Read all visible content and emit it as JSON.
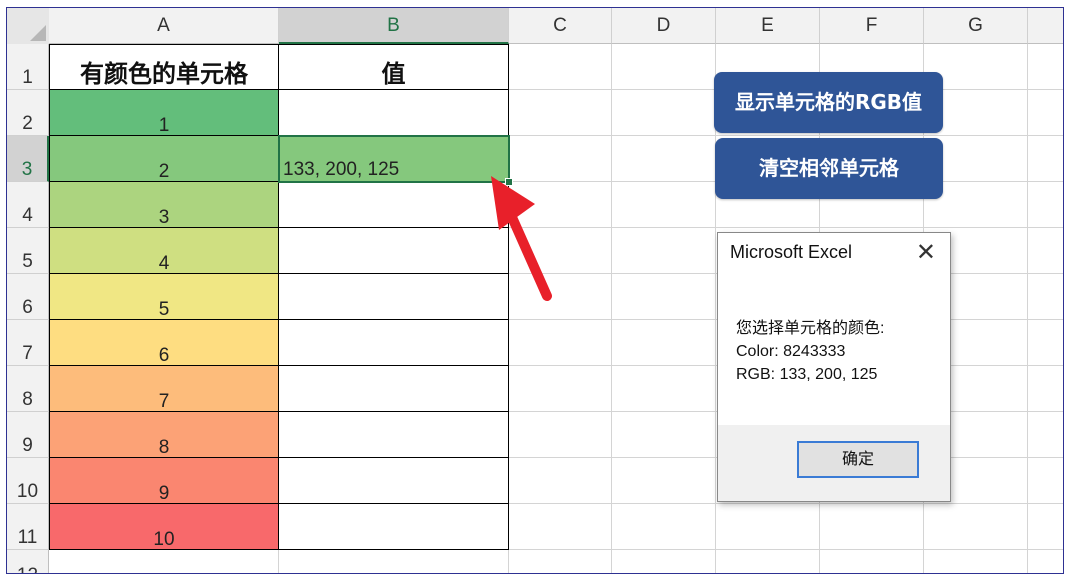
{
  "columns": [
    "A",
    "B",
    "C",
    "D",
    "E",
    "F",
    "G"
  ],
  "selected_column": "B",
  "rows": [
    "1",
    "2",
    "3",
    "4",
    "5",
    "6",
    "7",
    "8",
    "9",
    "10",
    "11",
    "12"
  ],
  "selected_row": "3",
  "table": {
    "header_a": "有颜色的单元格",
    "header_b": "值",
    "items": [
      {
        "label": "1",
        "color": "#63be7b",
        "value": ""
      },
      {
        "label": "2",
        "color": "#85c87d",
        "value": "133, 200, 125"
      },
      {
        "label": "3",
        "color": "#acd47f",
        "value": ""
      },
      {
        "label": "4",
        "color": "#cfdf81",
        "value": ""
      },
      {
        "label": "5",
        "color": "#f0e784",
        "value": ""
      },
      {
        "label": "6",
        "color": "#fedd81",
        "value": ""
      },
      {
        "label": "7",
        "color": "#fdbc7b",
        "value": ""
      },
      {
        "label": "8",
        "color": "#fca276",
        "value": ""
      },
      {
        "label": "9",
        "color": "#fa8670",
        "value": ""
      },
      {
        "label": "10",
        "color": "#f8696b",
        "value": ""
      }
    ]
  },
  "buttons": {
    "show_rgb": "显示单元格的RGB值",
    "clear": "清空相邻单元格"
  },
  "dialog": {
    "title": "Microsoft Excel",
    "line1": "您选择单元格的颜色:",
    "line2": "Color: 8243333",
    "line3": "RGB: 133, 200, 125",
    "ok_label": "确定"
  },
  "accent_colors": {
    "excel_green": "#217346",
    "button_blue": "#2f5597",
    "arrow_red": "#e8202a"
  }
}
